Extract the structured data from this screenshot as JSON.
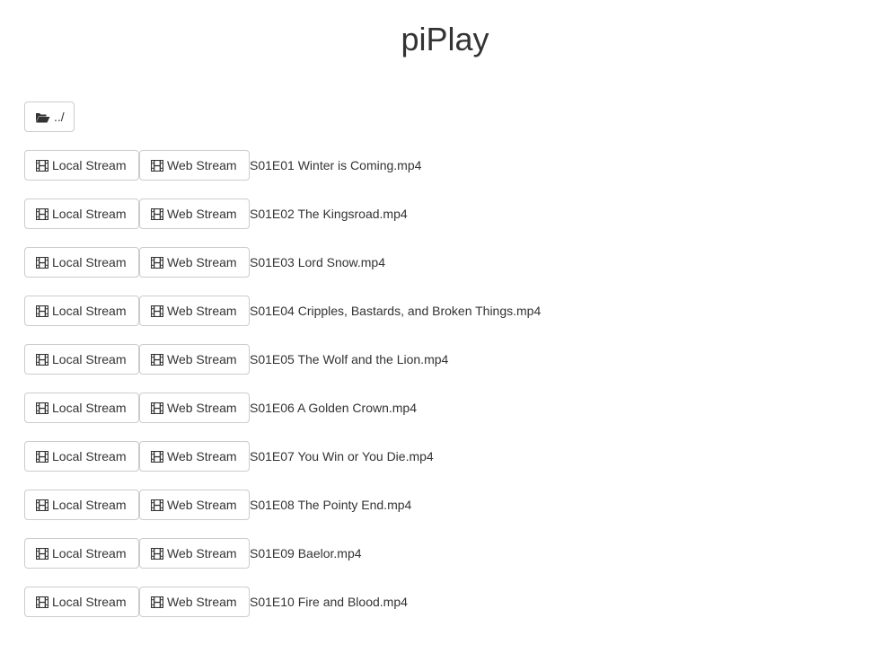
{
  "app": {
    "title": "piPlay"
  },
  "parent": {
    "label": "../",
    "icon": "folder-open-icon"
  },
  "buttons": {
    "local_label": "Local Stream",
    "web_label": "Web Stream",
    "icon": "film-icon"
  },
  "files": [
    "S01E01 Winter is Coming.mp4",
    "S01E02 The Kingsroad.mp4",
    "S01E03 Lord Snow.mp4",
    "S01E04 Cripples, Bastards, and Broken Things.mp4",
    "S01E05 The Wolf and the Lion.mp4",
    "S01E06 A Golden Crown.mp4",
    "S01E07 You Win or You Die.mp4",
    "S01E08 The Pointy End.mp4",
    "S01E09 Baelor.mp4",
    "S01E10 Fire and Blood.mp4"
  ],
  "colors": {
    "text": "#333333",
    "border": "#cccccc",
    "background": "#ffffff"
  }
}
